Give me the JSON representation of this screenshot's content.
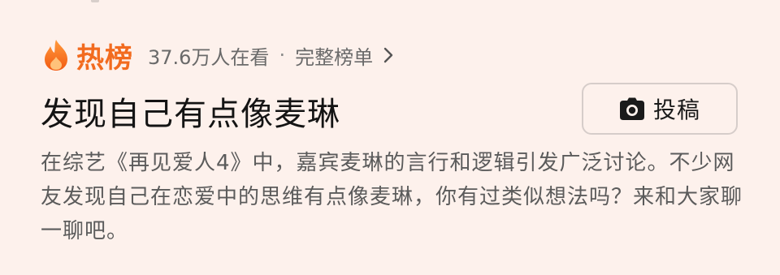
{
  "hot": {
    "label": "热榜",
    "viewers": "37.6万人在看",
    "separator": "·",
    "full_list": "完整榜单",
    "flame_icon": "flame-icon",
    "chevron_icon": "chevron-right-icon",
    "accent": "#f26b1f"
  },
  "topic": {
    "title": "发现自己有点像麦琳",
    "description": "在综艺《再见爱人4》中，嘉宾麦琳的言行和逻辑引发广泛讨论。不少网友发现自己在恋爱中的思维有点像麦琳，你有过类似想法吗？来和大家聊一聊吧。"
  },
  "post_button": {
    "label": "投稿",
    "icon": "camera-icon"
  }
}
